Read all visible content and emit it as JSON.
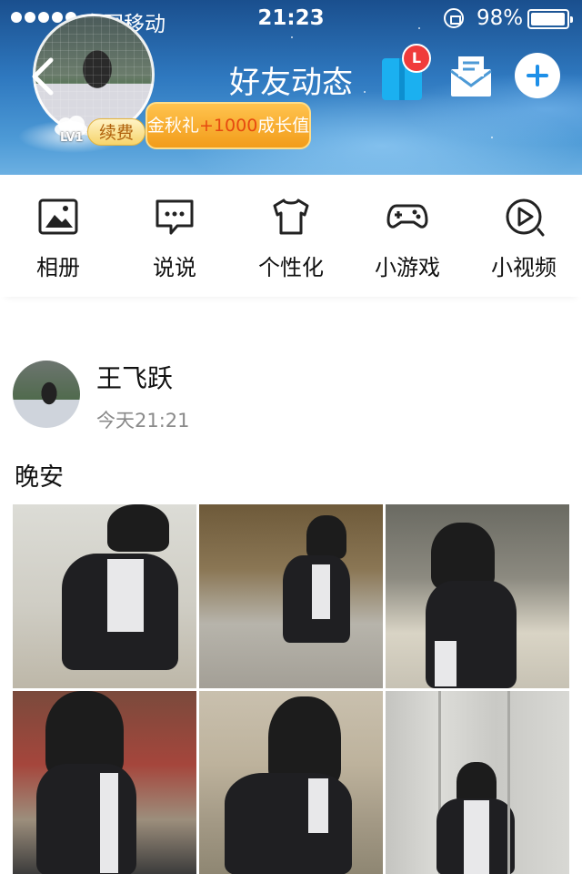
{
  "status_bar": {
    "carrier": "中国移动",
    "time": "21:23",
    "battery": "98%",
    "battery_level": 0.98
  },
  "header": {
    "title": "好友动态",
    "level": "LV1",
    "renew_label": "续费",
    "promo": {
      "prefix": "金秋礼",
      "amount": "+1000",
      "suffix": "成长值"
    },
    "notification_count": "L",
    "colors": {
      "header_blue": "#2f79c0",
      "badge_red": "#f03b3b",
      "promo_orange": "#f29c1a",
      "plus_blue": "#1d8fe8"
    }
  },
  "quick_nav": {
    "items": [
      {
        "label": "相册",
        "icon": "photo-album-icon"
      },
      {
        "label": "说说",
        "icon": "chat-bubble-icon"
      },
      {
        "label": "个性化",
        "icon": "tshirt-icon"
      },
      {
        "label": "小游戏",
        "icon": "gamepad-icon"
      },
      {
        "label": "小视频",
        "icon": "play-video-icon"
      }
    ]
  },
  "feed": {
    "post": {
      "username": "王飞跃",
      "time": "今天21:21",
      "text": "晚安",
      "photo_count": 6
    }
  }
}
